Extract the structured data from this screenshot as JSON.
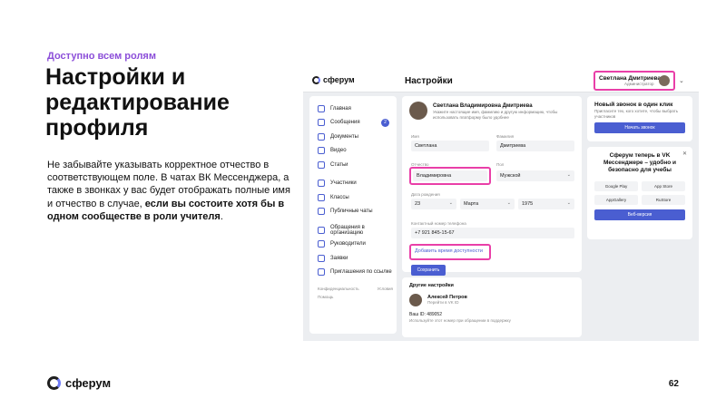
{
  "slide": {
    "tag": "Доступно всем ролям",
    "title": "Настройки и редактирование профиля",
    "body_plain": "Не забывайте указывать корректное отчество в соответствующем поле. В чатах ВК Мессенджера, а также в звонках у вас будет отображать полные имя и отчество в случае, ",
    "body_bold": "если вы состоите хотя бы в одном сообществе в роли учителя",
    "body_end": ".",
    "brand": "сферум",
    "page_number": "62"
  },
  "app": {
    "logo": "сферум",
    "page_title": "Настройки",
    "user": {
      "name": "Светлана Дмитриева",
      "role": "Администратор"
    },
    "sidebar": {
      "items": [
        {
          "label": "Главная",
          "icon": "home-icon"
        },
        {
          "label": "Сообщения",
          "icon": "chat-icon",
          "badge": "2"
        },
        {
          "label": "Документы",
          "icon": "document-icon"
        },
        {
          "label": "Видео",
          "icon": "video-icon"
        },
        {
          "label": "Статьи",
          "icon": "article-icon"
        },
        {
          "label": "Участники",
          "icon": "people-icon"
        },
        {
          "label": "Классы",
          "icon": "classes-icon"
        },
        {
          "label": "Публичные чаты",
          "icon": "public-chat-icon"
        },
        {
          "label": "Обращения в организацию",
          "icon": "appeal-icon"
        },
        {
          "label": "Руководители",
          "icon": "manager-icon"
        },
        {
          "label": "Заявки",
          "icon": "request-icon"
        },
        {
          "label": "Приглашения по ссылке",
          "icon": "link-icon"
        }
      ],
      "footer_privacy": "Конфиденциальность",
      "footer_terms": "Условия",
      "footer_help": "Помощь"
    },
    "profile": {
      "name": "Светлана Владимировна Дмитриева",
      "description": "Укажите настоящие имя, фамилию и другую информацию, чтобы использовать платформу было удобнее",
      "first_name_label": "Имя",
      "first_name": "Светлана",
      "last_name_label": "Фамилия",
      "last_name": "Дмитриева",
      "patronymic_label": "Отчество",
      "patronymic": "Владимировна",
      "gender_label": "Пол",
      "gender": "Мужской",
      "birth_label": "Дата рождения",
      "birth_day": "23",
      "birth_month": "Марта",
      "birth_year": "1975",
      "phone_label": "Контактный номер телефона",
      "phone": "+7 921 845-15-67",
      "availability_link": "Добавить время доступности",
      "save_label": "Сохранить"
    },
    "other_settings": {
      "title": "Другие настройки",
      "person_name": "Алексей Петров",
      "person_sub": "Перейти в VK ID",
      "id_text": "Ваш ID: 489052",
      "hint": "Используйте этот номер при обращении в поддержку"
    },
    "call_card": {
      "title": "Новый звонок в один клик",
      "subtitle": "Пригласите тех, кого хотите, чтобы выбрать участников",
      "button": "Начать звонок"
    },
    "promo_card": {
      "title": "Сферум теперь в VK Мессенджере – удобно и безопасно для учебы",
      "stores": [
        "Google Play",
        "App Store",
        "AppGallery",
        "RuStore"
      ],
      "button": "Веб-версия"
    }
  }
}
